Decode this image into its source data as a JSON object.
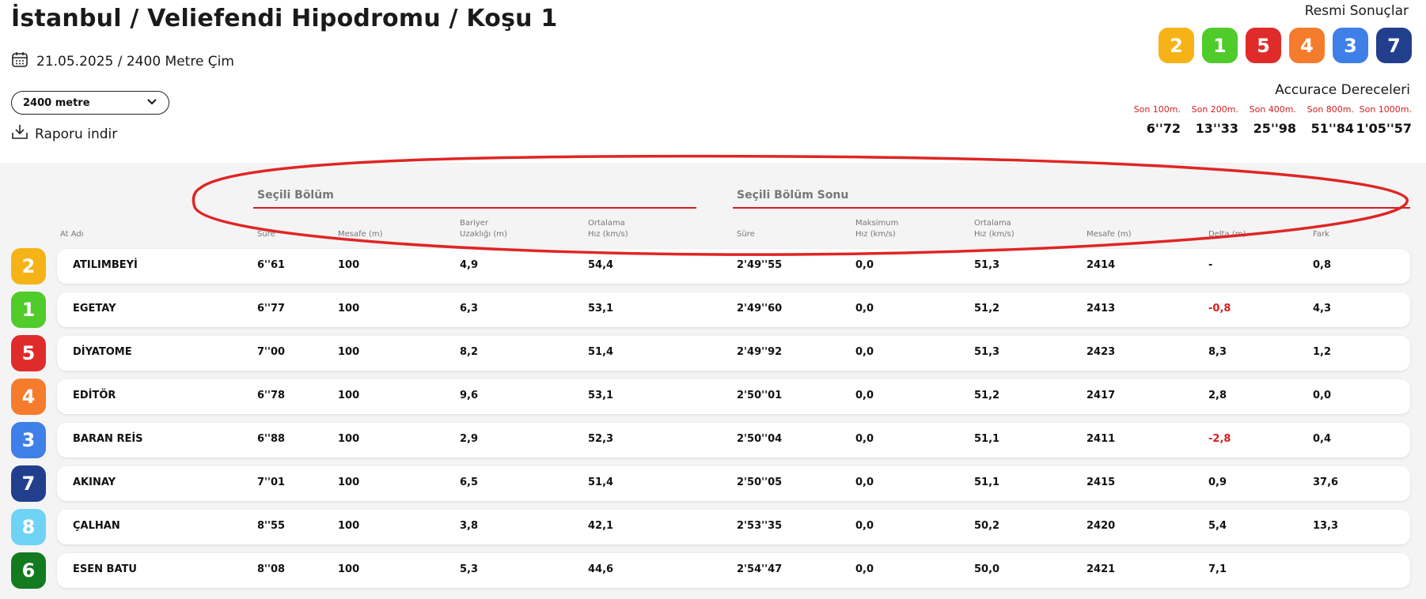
{
  "header": {
    "title": "İstanbul / Veliefendi Hipodromu / Koşu 1",
    "date_info": "21.05.2025 / 2400 Metre Çim",
    "distance_select": "2400 metre",
    "download_label": "Raporu indir",
    "calendar_icon": "calendar-icon",
    "download_icon": "download-icon"
  },
  "official_results": {
    "label": "Resmi Sonuçlar",
    "badges": [
      {
        "number": "2",
        "color": "#f6b318"
      },
      {
        "number": "1",
        "color": "#4fcb2a"
      },
      {
        "number": "5",
        "color": "#e02b2b"
      },
      {
        "number": "4",
        "color": "#f57b2d"
      },
      {
        "number": "3",
        "color": "#3f7fe8"
      },
      {
        "number": "7",
        "color": "#223f8e"
      }
    ]
  },
  "accuracy": {
    "label": "Accurace Dereceleri",
    "items": [
      {
        "label": "Son 100m.",
        "value": "6''72"
      },
      {
        "label": "Son 200m.",
        "value": "13''33"
      },
      {
        "label": "Son 400m.",
        "value": "25''98"
      },
      {
        "label": "Son 800m.",
        "value": "51''84"
      },
      {
        "label": "Son 1000m.",
        "value": "1'05''57"
      }
    ]
  },
  "sections": {
    "selected": "Seçili Bölüm",
    "selected_end": "Seçili Bölüm Sonu"
  },
  "columns": {
    "horse": "At Adı",
    "time": "Süre",
    "distance": "Mesafe (m)",
    "barrier_1": "Bariyer",
    "barrier_2": "Uzaklığı (m)",
    "avg_1": "Ortalama",
    "avg_2": "Hız (km/s)",
    "end_time": "Süre",
    "max_1": "Maksimum",
    "max_2": "Hız (km/s)",
    "end_avg_1": "Ortalama",
    "end_avg_2": "Hız (km/s)",
    "end_distance": "Mesafe (m)",
    "delta": "Delta (m)",
    "diff": "Fark"
  },
  "rows": [
    {
      "num": "2",
      "color": "#f6b318",
      "name": "ATILIMBEYİ",
      "time": "6''61",
      "dist": "100",
      "barrier": "4,9",
      "avg": "54,4",
      "end_time": "2'49''55",
      "max": "0,0",
      "end_avg": "51,3",
      "end_dist": "2414",
      "delta": "-",
      "delta_neg": false,
      "diff": "0,8"
    },
    {
      "num": "1",
      "color": "#4fcb2a",
      "name": "EGETAY",
      "time": "6''77",
      "dist": "100",
      "barrier": "6,3",
      "avg": "53,1",
      "end_time": "2'49''60",
      "max": "0,0",
      "end_avg": "51,2",
      "end_dist": "2413",
      "delta": "-0,8",
      "delta_neg": true,
      "diff": "4,3"
    },
    {
      "num": "5",
      "color": "#e02b2b",
      "name": "DİYATOME",
      "time": "7''00",
      "dist": "100",
      "barrier": "8,2",
      "avg": "51,4",
      "end_time": "2'49''92",
      "max": "0,0",
      "end_avg": "51,3",
      "end_dist": "2423",
      "delta": "8,3",
      "delta_neg": false,
      "diff": "1,2"
    },
    {
      "num": "4",
      "color": "#f57b2d",
      "name": "EDİTÖR",
      "time": "6''78",
      "dist": "100",
      "barrier": "9,6",
      "avg": "53,1",
      "end_time": "2'50''01",
      "max": "0,0",
      "end_avg": "51,2",
      "end_dist": "2417",
      "delta": "2,8",
      "delta_neg": false,
      "diff": "0,0"
    },
    {
      "num": "3",
      "color": "#3f7fe8",
      "name": "BARAN REİS",
      "time": "6''88",
      "dist": "100",
      "barrier": "2,9",
      "avg": "52,3",
      "end_time": "2'50''04",
      "max": "0,0",
      "end_avg": "51,1",
      "end_dist": "2411",
      "delta": "-2,8",
      "delta_neg": true,
      "diff": "0,4"
    },
    {
      "num": "7",
      "color": "#223f8e",
      "name": "AKINAY",
      "time": "7''01",
      "dist": "100",
      "barrier": "6,5",
      "avg": "51,4",
      "end_time": "2'50''05",
      "max": "0,0",
      "end_avg": "51,1",
      "end_dist": "2415",
      "delta": "0,9",
      "delta_neg": false,
      "diff": "37,6"
    },
    {
      "num": "8",
      "color": "#6fd3f5",
      "name": "ÇALHAN",
      "time": "8''55",
      "dist": "100",
      "barrier": "3,8",
      "avg": "42,1",
      "end_time": "2'53''35",
      "max": "0,0",
      "end_avg": "50,2",
      "end_dist": "2420",
      "delta": "5,4",
      "delta_neg": false,
      "diff": "13,3"
    },
    {
      "num": "6",
      "color": "#137a1f",
      "name": "ESEN BATU",
      "time": "8''08",
      "dist": "100",
      "barrier": "5,3",
      "avg": "44,6",
      "end_time": "2'54''47",
      "max": "0,0",
      "end_avg": "50,0",
      "end_dist": "2421",
      "delta": "7,1",
      "delta_neg": false,
      "diff": ""
    }
  ],
  "annotation": {
    "color": "#e02525"
  }
}
